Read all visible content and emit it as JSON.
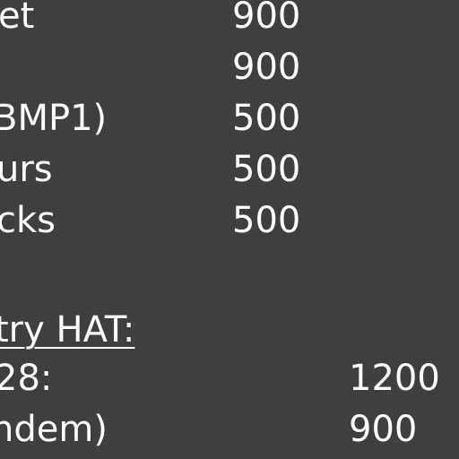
{
  "slide": {
    "background": "#3f3f3f",
    "text_color": "#ffffff",
    "rows": [
      {
        "label": "et",
        "value": "900"
      },
      {
        "label": "",
        "value": "900"
      },
      {
        "label": "BMP1)",
        "value": "500"
      },
      {
        "label": "urs",
        "value": "500"
      },
      {
        "label": "cks",
        "value": "500"
      }
    ],
    "section_heading": "try HAT:",
    "section_rows": [
      {
        "label": "28:",
        "value": "1200"
      },
      {
        "label": "ndem)",
        "value": "900"
      }
    ]
  }
}
